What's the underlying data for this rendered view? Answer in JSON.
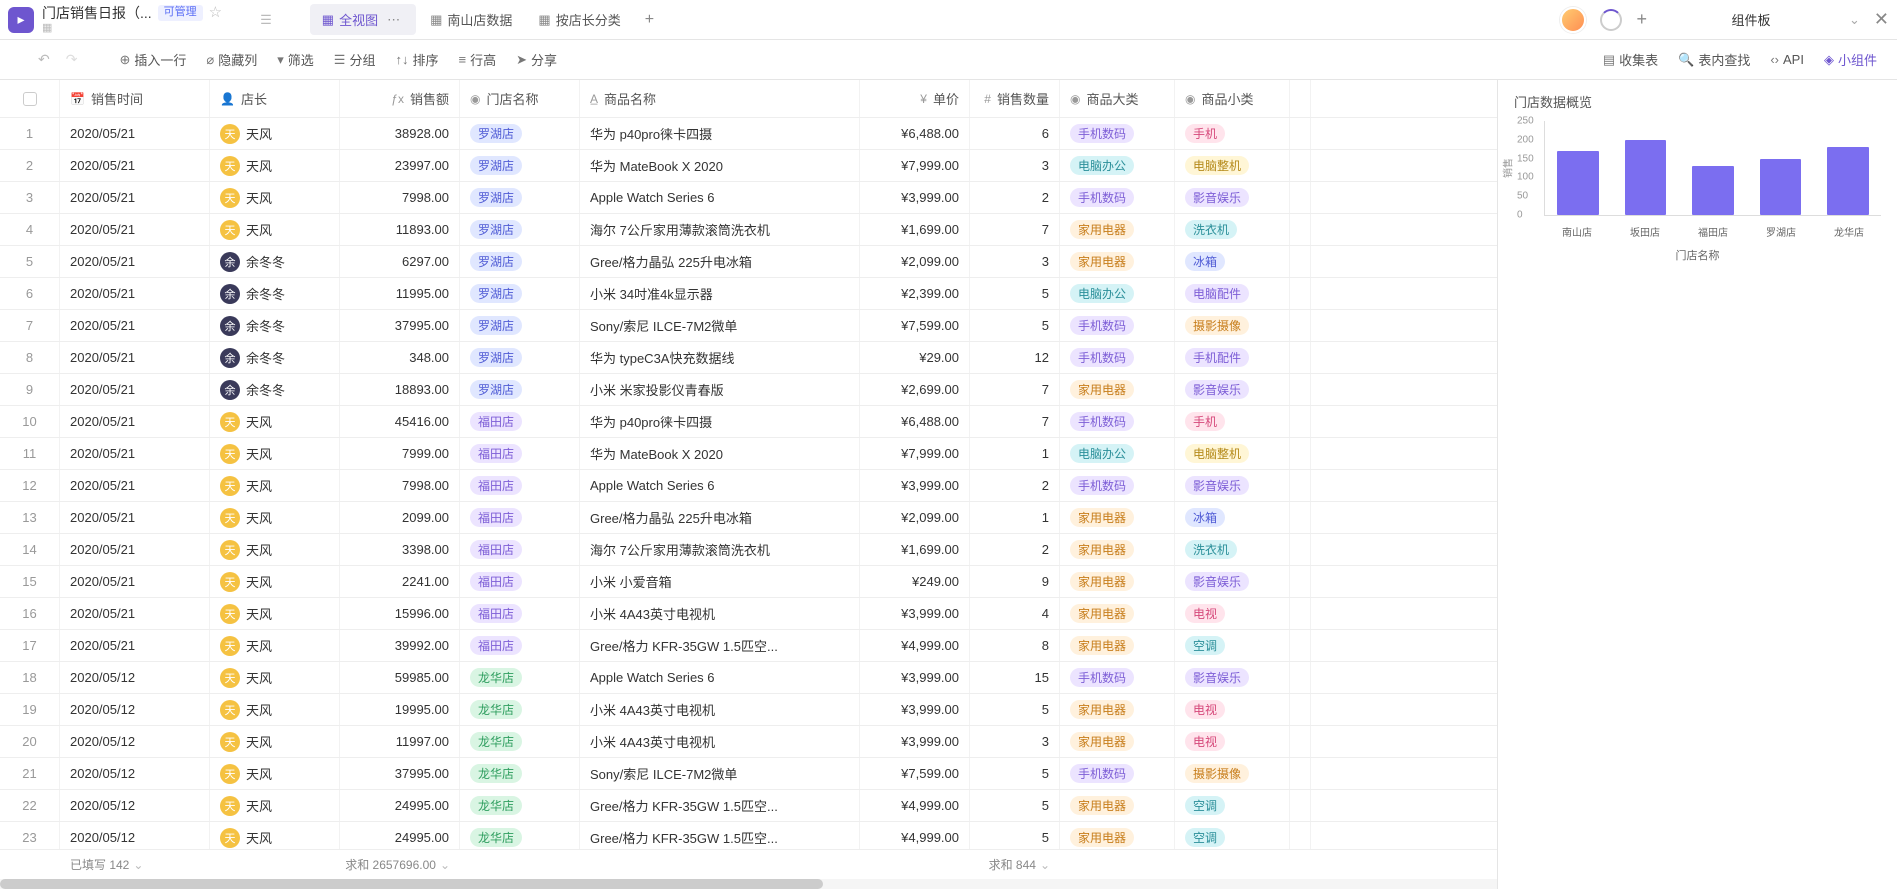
{
  "doc": {
    "title": "门店销售日报（...",
    "permission": "可管理"
  },
  "tabs": [
    {
      "label": "全视图",
      "active": true
    },
    {
      "label": "南山店数据",
      "active": false
    },
    {
      "label": "按店长分类",
      "active": false
    }
  ],
  "panel_header": "组件板",
  "toolbar": {
    "insert_row": "插入一行",
    "hide_col": "隐藏列",
    "filter": "筛选",
    "group": "分组",
    "sort": "排序",
    "row_height": "行高",
    "share": "分享",
    "collect": "收集表",
    "search": "表内查找",
    "api": "API",
    "widget": "小组件"
  },
  "columns": {
    "date": "销售时间",
    "manager": "店长",
    "amount": "销售额",
    "store": "门店名称",
    "product": "商品名称",
    "price": "单价",
    "qty": "销售数量",
    "cat": "商品大类",
    "sub": "商品小类"
  },
  "rows": [
    {
      "idx": 1,
      "date": "2020/05/21",
      "mgr": "天风",
      "mgrAv": "yellow",
      "amount": "38928.00",
      "store": "罗湖店",
      "storeC": "t-blue",
      "product": "华为 p40pro徕卡四摄",
      "price": "¥6,488.00",
      "qty": 6,
      "cat": "手机数码",
      "catC": "t-purple",
      "sub": "手机",
      "subC": "t-pink"
    },
    {
      "idx": 2,
      "date": "2020/05/21",
      "mgr": "天风",
      "mgrAv": "yellow",
      "amount": "23997.00",
      "store": "罗湖店",
      "storeC": "t-blue",
      "product": "华为 MateBook X 2020",
      "price": "¥7,999.00",
      "qty": 3,
      "cat": "电脑办公",
      "catC": "t-cyan",
      "sub": "电脑整机",
      "subC": "t-yellow"
    },
    {
      "idx": 3,
      "date": "2020/05/21",
      "mgr": "天风",
      "mgrAv": "yellow",
      "amount": "7998.00",
      "store": "罗湖店",
      "storeC": "t-blue",
      "product": "Apple Watch Series 6",
      "price": "¥3,999.00",
      "qty": 2,
      "cat": "手机数码",
      "catC": "t-purple",
      "sub": "影音娱乐",
      "subC": "t-purple"
    },
    {
      "idx": 4,
      "date": "2020/05/21",
      "mgr": "天风",
      "mgrAv": "yellow",
      "amount": "11893.00",
      "store": "罗湖店",
      "storeC": "t-blue",
      "product": "海尔 7公斤家用薄款滚筒洗衣机",
      "price": "¥1,699.00",
      "qty": 7,
      "cat": "家用电器",
      "catC": "t-orange",
      "sub": "洗衣机",
      "subC": "t-cyan"
    },
    {
      "idx": 5,
      "date": "2020/05/21",
      "mgr": "余冬冬",
      "mgrAv": "dark",
      "amount": "6297.00",
      "store": "罗湖店",
      "storeC": "t-blue",
      "product": "Gree/格力晶弘 225升电冰箱",
      "price": "¥2,099.00",
      "qty": 3,
      "cat": "家用电器",
      "catC": "t-orange",
      "sub": "冰箱",
      "subC": "t-blue"
    },
    {
      "idx": 6,
      "date": "2020/05/21",
      "mgr": "余冬冬",
      "mgrAv": "dark",
      "amount": "11995.00",
      "store": "罗湖店",
      "storeC": "t-blue",
      "product": "小米 34吋准4k显示器",
      "price": "¥2,399.00",
      "qty": 5,
      "cat": "电脑办公",
      "catC": "t-cyan",
      "sub": "电脑配件",
      "subC": "t-purple"
    },
    {
      "idx": 7,
      "date": "2020/05/21",
      "mgr": "余冬冬",
      "mgrAv": "dark",
      "amount": "37995.00",
      "store": "罗湖店",
      "storeC": "t-blue",
      "product": "Sony/索尼 ILCE-7M2微单",
      "price": "¥7,599.00",
      "qty": 5,
      "cat": "手机数码",
      "catC": "t-purple",
      "sub": "摄影摄像",
      "subC": "t-orange"
    },
    {
      "idx": 8,
      "date": "2020/05/21",
      "mgr": "余冬冬",
      "mgrAv": "dark",
      "amount": "348.00",
      "store": "罗湖店",
      "storeC": "t-blue",
      "product": "华为 typeC3A快充数据线",
      "price": "¥29.00",
      "qty": 12,
      "cat": "手机数码",
      "catC": "t-purple",
      "sub": "手机配件",
      "subC": "t-purple"
    },
    {
      "idx": 9,
      "date": "2020/05/21",
      "mgr": "余冬冬",
      "mgrAv": "dark",
      "amount": "18893.00",
      "store": "罗湖店",
      "storeC": "t-blue",
      "product": "小米 米家投影仪青春版",
      "price": "¥2,699.00",
      "qty": 7,
      "cat": "家用电器",
      "catC": "t-orange",
      "sub": "影音娱乐",
      "subC": "t-purple"
    },
    {
      "idx": 10,
      "date": "2020/05/21",
      "mgr": "天风",
      "mgrAv": "yellow",
      "amount": "45416.00",
      "store": "福田店",
      "storeC": "t-purple",
      "product": "华为 p40pro徕卡四摄",
      "price": "¥6,488.00",
      "qty": 7,
      "cat": "手机数码",
      "catC": "t-purple",
      "sub": "手机",
      "subC": "t-pink"
    },
    {
      "idx": 11,
      "date": "2020/05/21",
      "mgr": "天风",
      "mgrAv": "yellow",
      "amount": "7999.00",
      "store": "福田店",
      "storeC": "t-purple",
      "product": "华为 MateBook X 2020",
      "price": "¥7,999.00",
      "qty": 1,
      "cat": "电脑办公",
      "catC": "t-cyan",
      "sub": "电脑整机",
      "subC": "t-yellow"
    },
    {
      "idx": 12,
      "date": "2020/05/21",
      "mgr": "天风",
      "mgrAv": "yellow",
      "amount": "7998.00",
      "store": "福田店",
      "storeC": "t-purple",
      "product": "Apple Watch Series 6",
      "price": "¥3,999.00",
      "qty": 2,
      "cat": "手机数码",
      "catC": "t-purple",
      "sub": "影音娱乐",
      "subC": "t-purple"
    },
    {
      "idx": 13,
      "date": "2020/05/21",
      "mgr": "天风",
      "mgrAv": "yellow",
      "amount": "2099.00",
      "store": "福田店",
      "storeC": "t-purple",
      "product": "Gree/格力晶弘 225升电冰箱",
      "price": "¥2,099.00",
      "qty": 1,
      "cat": "家用电器",
      "catC": "t-orange",
      "sub": "冰箱",
      "subC": "t-blue"
    },
    {
      "idx": 14,
      "date": "2020/05/21",
      "mgr": "天风",
      "mgrAv": "yellow",
      "amount": "3398.00",
      "store": "福田店",
      "storeC": "t-purple",
      "product": "海尔 7公斤家用薄款滚筒洗衣机",
      "price": "¥1,699.00",
      "qty": 2,
      "cat": "家用电器",
      "catC": "t-orange",
      "sub": "洗衣机",
      "subC": "t-cyan"
    },
    {
      "idx": 15,
      "date": "2020/05/21",
      "mgr": "天风",
      "mgrAv": "yellow",
      "amount": "2241.00",
      "store": "福田店",
      "storeC": "t-purple",
      "product": "小米 小爱音箱",
      "price": "¥249.00",
      "qty": 9,
      "cat": "家用电器",
      "catC": "t-orange",
      "sub": "影音娱乐",
      "subC": "t-purple"
    },
    {
      "idx": 16,
      "date": "2020/05/21",
      "mgr": "天风",
      "mgrAv": "yellow",
      "amount": "15996.00",
      "store": "福田店",
      "storeC": "t-purple",
      "product": "小米 4A43英寸电视机",
      "price": "¥3,999.00",
      "qty": 4,
      "cat": "家用电器",
      "catC": "t-orange",
      "sub": "电视",
      "subC": "t-pink"
    },
    {
      "idx": 17,
      "date": "2020/05/21",
      "mgr": "天风",
      "mgrAv": "yellow",
      "amount": "39992.00",
      "store": "福田店",
      "storeC": "t-purple",
      "product": "Gree/格力 KFR-35GW 1.5匹空...",
      "price": "¥4,999.00",
      "qty": 8,
      "cat": "家用电器",
      "catC": "t-orange",
      "sub": "空调",
      "subC": "t-cyan"
    },
    {
      "idx": 18,
      "date": "2020/05/12",
      "mgr": "天风",
      "mgrAv": "yellow",
      "amount": "59985.00",
      "store": "龙华店",
      "storeC": "t-green",
      "product": "Apple Watch Series 6",
      "price": "¥3,999.00",
      "qty": 15,
      "cat": "手机数码",
      "catC": "t-purple",
      "sub": "影音娱乐",
      "subC": "t-purple"
    },
    {
      "idx": 19,
      "date": "2020/05/12",
      "mgr": "天风",
      "mgrAv": "yellow",
      "amount": "19995.00",
      "store": "龙华店",
      "storeC": "t-green",
      "product": "小米 4A43英寸电视机",
      "price": "¥3,999.00",
      "qty": 5,
      "cat": "家用电器",
      "catC": "t-orange",
      "sub": "电视",
      "subC": "t-pink"
    },
    {
      "idx": 20,
      "date": "2020/05/12",
      "mgr": "天风",
      "mgrAv": "yellow",
      "amount": "11997.00",
      "store": "龙华店",
      "storeC": "t-green",
      "product": "小米 4A43英寸电视机",
      "price": "¥3,999.00",
      "qty": 3,
      "cat": "家用电器",
      "catC": "t-orange",
      "sub": "电视",
      "subC": "t-pink"
    },
    {
      "idx": 21,
      "date": "2020/05/12",
      "mgr": "天风",
      "mgrAv": "yellow",
      "amount": "37995.00",
      "store": "龙华店",
      "storeC": "t-green",
      "product": "Sony/索尼 ILCE-7M2微单",
      "price": "¥7,599.00",
      "qty": 5,
      "cat": "手机数码",
      "catC": "t-purple",
      "sub": "摄影摄像",
      "subC": "t-orange"
    },
    {
      "idx": 22,
      "date": "2020/05/12",
      "mgr": "天风",
      "mgrAv": "yellow",
      "amount": "24995.00",
      "store": "龙华店",
      "storeC": "t-green",
      "product": "Gree/格力 KFR-35GW 1.5匹空...",
      "price": "¥4,999.00",
      "qty": 5,
      "cat": "家用电器",
      "catC": "t-orange",
      "sub": "空调",
      "subC": "t-cyan"
    },
    {
      "idx": 23,
      "date": "2020/05/12",
      "mgr": "天风",
      "mgrAv": "yellow",
      "amount": "24995.00",
      "store": "龙华店",
      "storeC": "t-green",
      "product": "Gree/格力 KFR-35GW 1.5匹空...",
      "price": "¥4,999.00",
      "qty": 5,
      "cat": "家用电器",
      "catC": "t-orange",
      "sub": "空调",
      "subC": "t-cyan"
    }
  ],
  "footer": {
    "filled": "已填写 142",
    "amount_sum": "求和 2657696.00",
    "qty_sum": "求和 844"
  },
  "side": {
    "title": "门店数据概览",
    "xlabel": "门店名称",
    "ylabel": "销售"
  },
  "chart_data": {
    "type": "bar",
    "categories": [
      "南山店",
      "坂田店",
      "福田店",
      "罗湖店",
      "龙华店"
    ],
    "values": [
      170,
      200,
      130,
      150,
      180
    ],
    "title": "门店数据概览",
    "xlabel": "门店名称",
    "ylabel": "销售",
    "ylim": [
      0,
      250
    ],
    "yticks": [
      0,
      50,
      100,
      150,
      200,
      250
    ]
  }
}
